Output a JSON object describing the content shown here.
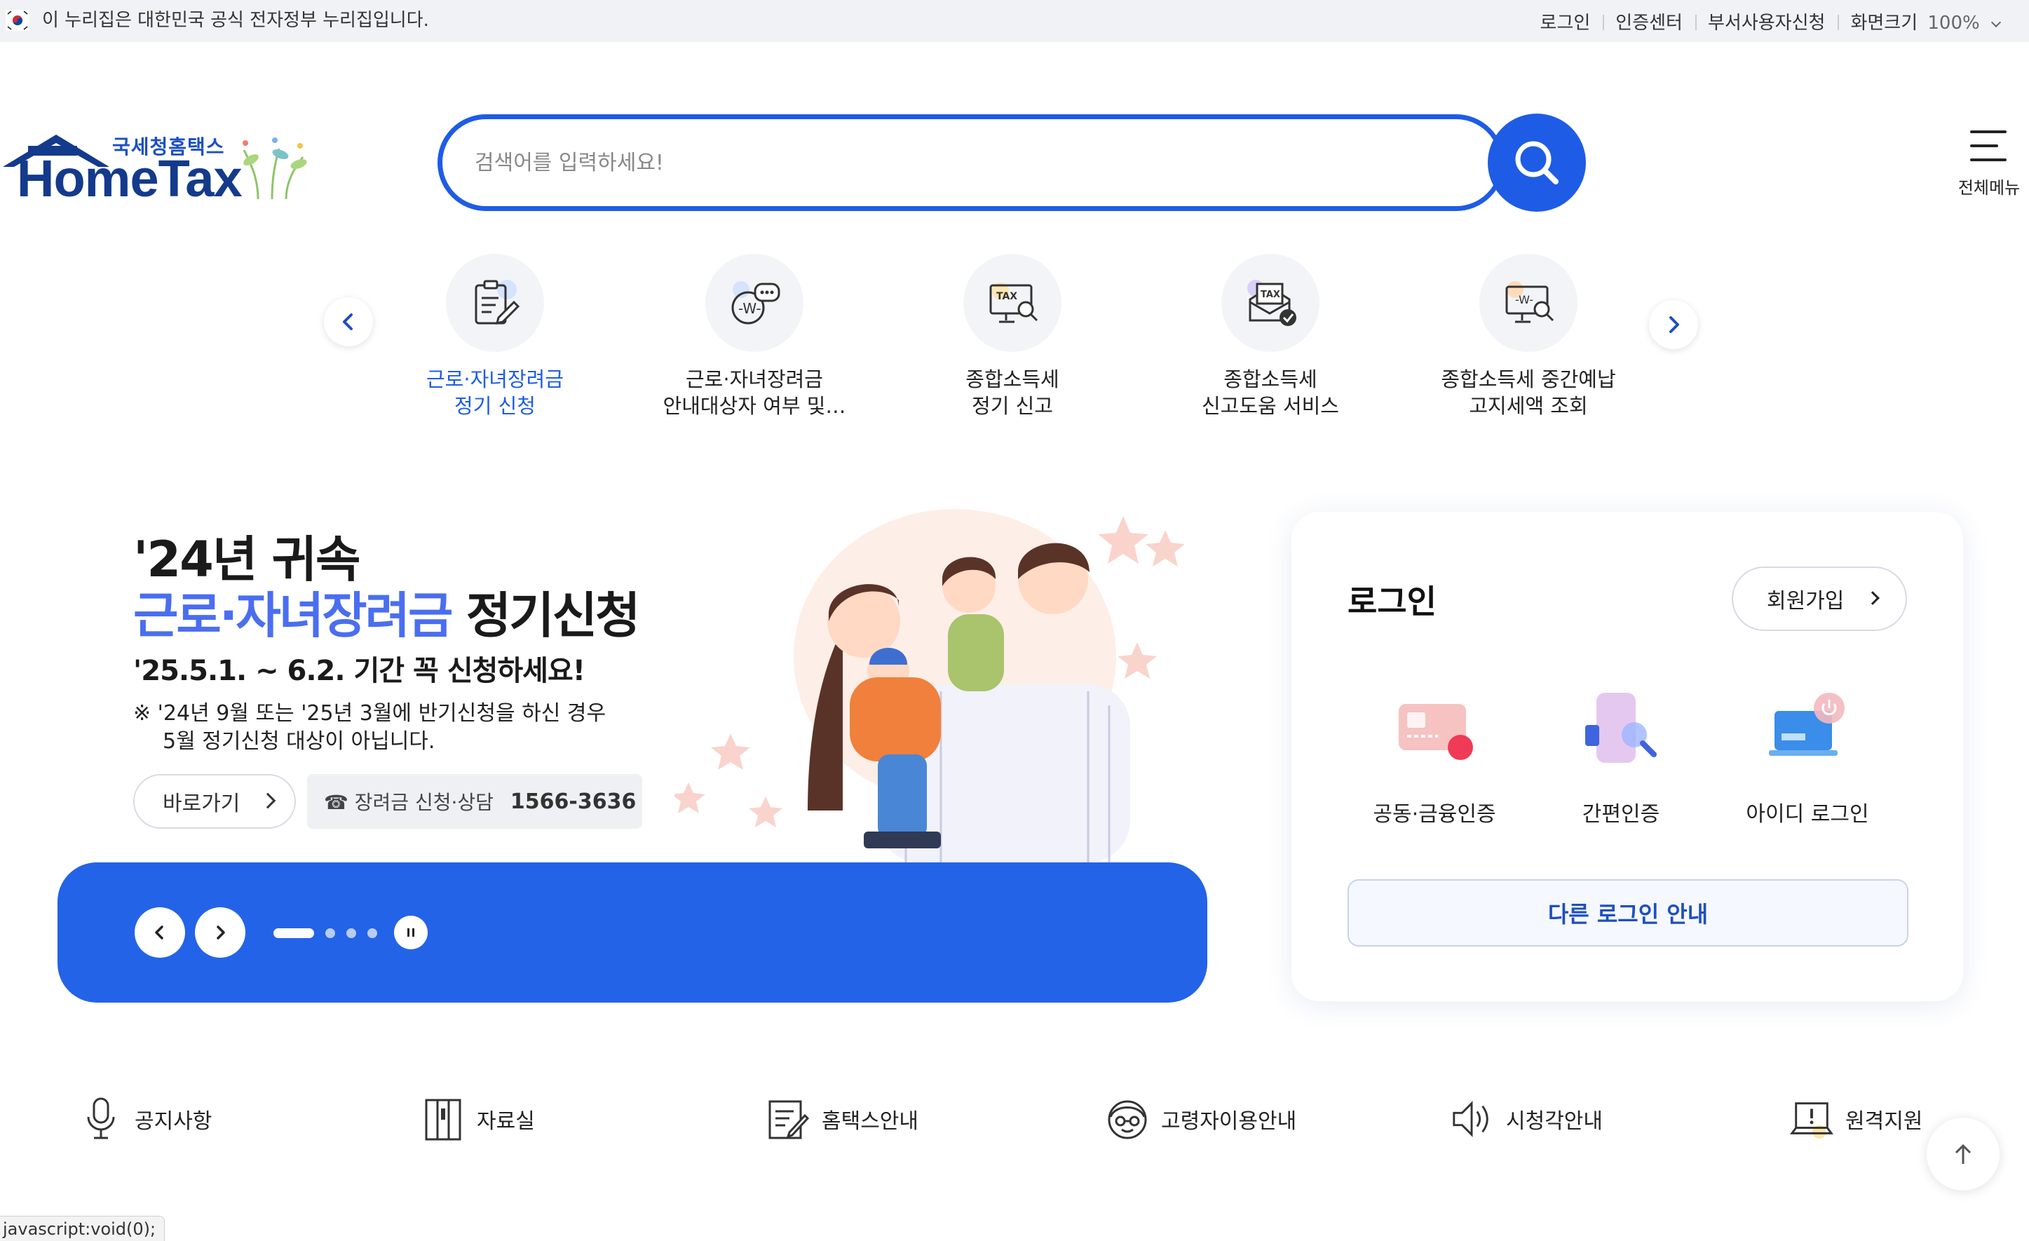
{
  "govbar": {
    "text": "이 누리집은 대한민국 공식 전자정부 누리집입니다.",
    "links": [
      "로그인",
      "인증센터",
      "부서사용자신청"
    ],
    "zoom_label": "화면크기",
    "zoom_value": "100%"
  },
  "logo": {
    "sub": "국세청홈택스",
    "main": "HomeTax"
  },
  "search": {
    "placeholder": "검색어를 입력하세요!",
    "value": ""
  },
  "allmenu": {
    "label": "전체메뉴"
  },
  "quick": [
    {
      "line1": "근로·자녀장려금",
      "line2": "정기 신청",
      "active": true
    },
    {
      "line1": "근로·자녀장려금",
      "line2": "안내대상자 여부 및…",
      "active": false
    },
    {
      "line1": "종합소득세",
      "line2": "정기 신고",
      "active": false
    },
    {
      "line1": "종합소득세",
      "line2": "신고도움 서비스",
      "active": false
    },
    {
      "line1": "종합소득세 중간예납",
      "line2": "고지세액 조회",
      "active": false
    }
  ],
  "banner": {
    "title1": "'24년 귀속",
    "title2_highlight": "근로·자녀장려금",
    "title2_rest": " 정기신청",
    "period": "'25.5.1. ~ 6.2. 기간 꼭 신청하세요!",
    "note1": "※ '24년 9월 또는 '25년 3월에 반기신청을 하신 경우",
    "note2": "5월 정기신청 대상이 아닙니다.",
    "go_label": "바로가기",
    "tel_label": "☎ 장려금 신청·상담",
    "tel_number": "1566-3636"
  },
  "slider": {
    "total_dots": 4,
    "active_dot": 1
  },
  "login": {
    "title": "로그인",
    "join": "회원가입",
    "options": [
      "공동·금융인증",
      "간편인증",
      "아이디 로그인"
    ],
    "other": "다른 로그인 안내"
  },
  "bottom_links": [
    "공지사항",
    "자료실",
    "홈택스안내",
    "고령자이용안내",
    "시청각안내",
    "원격지원"
  ],
  "statusbar": "javascript:void(0);",
  "colors": {
    "primary": "#1e5ce6",
    "banner_bar": "#2363e8",
    "highlight": "#4a6ef0"
  }
}
